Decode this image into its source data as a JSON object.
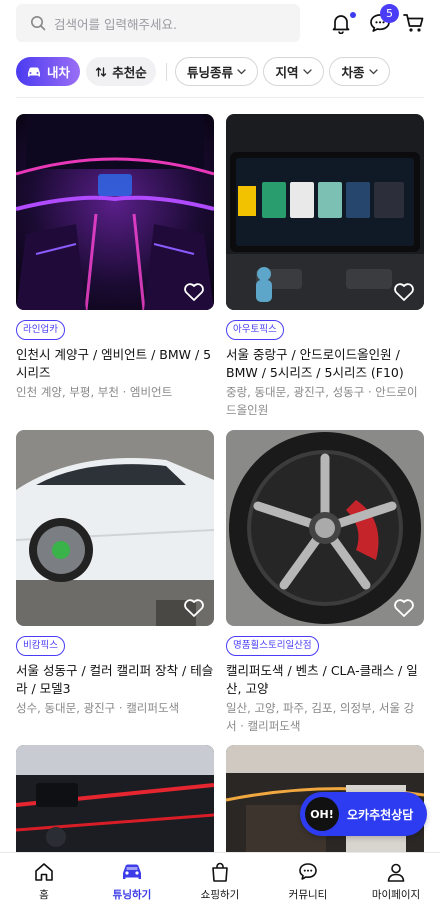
{
  "search": {
    "placeholder": "검색어를 입력해주세요."
  },
  "header": {
    "chat_badge": "5"
  },
  "filters": {
    "my_car": "내차",
    "sort": "추천순",
    "tuning_type": "튜닝종류",
    "region": "지역",
    "car_type": "차종"
  },
  "cards": [
    {
      "tag": "라인업카",
      "title": "인천시 계양구 / 엠비언트 / BMW / 5시리즈",
      "sub": "인천 계양, 부평, 부천 · 엠비언트"
    },
    {
      "tag": "아우토픽스",
      "title": "서울 중랑구 / 안드로이드올인원 / BMW / 5시리즈 / 5시리즈 (F10)",
      "sub": "중랑, 동대문, 광진구, 성동구 · 안드로이드올인원"
    },
    {
      "tag": "비캄픽스",
      "title": "서울 성동구 / 컬러 캘리퍼 장착 / 테슬라 / 모델3",
      "sub": "성수, 동대문, 광진구 · 캘리퍼도색"
    },
    {
      "tag": "명품휠스토리일산점",
      "title": "캘리퍼도색 / 벤츠 / CLA-클래스 / 일산, 고양",
      "sub": "일산, 고양, 파주, 김포, 의정부, 서울 강서 · 캘리퍼도색"
    }
  ],
  "fab": {
    "icon_text": "OH!",
    "label": "오카추천상담"
  },
  "nav": [
    {
      "label": "홈"
    },
    {
      "label": "튜닝하기"
    },
    {
      "label": "쇼핑하기"
    },
    {
      "label": "커뮤니티"
    },
    {
      "label": "마이페이지"
    }
  ],
  "colors": {
    "accent": "#4a3df5",
    "fab": "#2d3cf0"
  }
}
